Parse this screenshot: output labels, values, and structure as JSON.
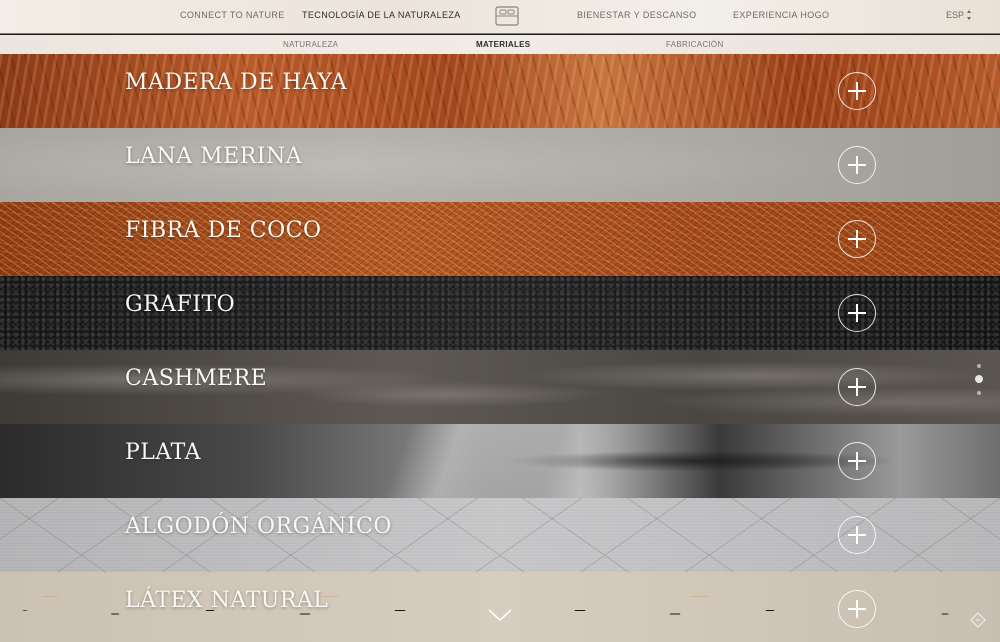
{
  "nav": {
    "links": [
      {
        "label": "CONNECT TO NATURE",
        "active": false
      },
      {
        "label": "TECNOLOGÍA DE LA NATURALEZA",
        "active": true
      },
      {
        "label": "BIENESTAR Y DESCANSO",
        "active": false
      },
      {
        "label": "EXPERIENCIA HOGO",
        "active": false
      }
    ],
    "logo_icon": "bed-icon",
    "language": "ESP"
  },
  "subnav": {
    "links": [
      {
        "label": "NATURALEZA",
        "active": false
      },
      {
        "label": "MATERIALES",
        "active": true
      },
      {
        "label": "FABRICACIÓN",
        "active": false
      }
    ]
  },
  "materials": [
    {
      "title": "MADERA DE HAYA"
    },
    {
      "title": "LANA MERINA"
    },
    {
      "title": "FIBRA DE COCO"
    },
    {
      "title": "GRAFITO"
    },
    {
      "title": "CASHMERE"
    },
    {
      "title": "PLATA"
    },
    {
      "title": "ALGODÓN ORGÁNICO"
    },
    {
      "title": "LÁTEX NATURAL"
    }
  ],
  "pager": {
    "count": 3,
    "active_index": 1
  },
  "colors": {
    "text_light": "#fbf8f4",
    "nav_text": "#6f6a64",
    "nav_active": "#2e2b28"
  }
}
